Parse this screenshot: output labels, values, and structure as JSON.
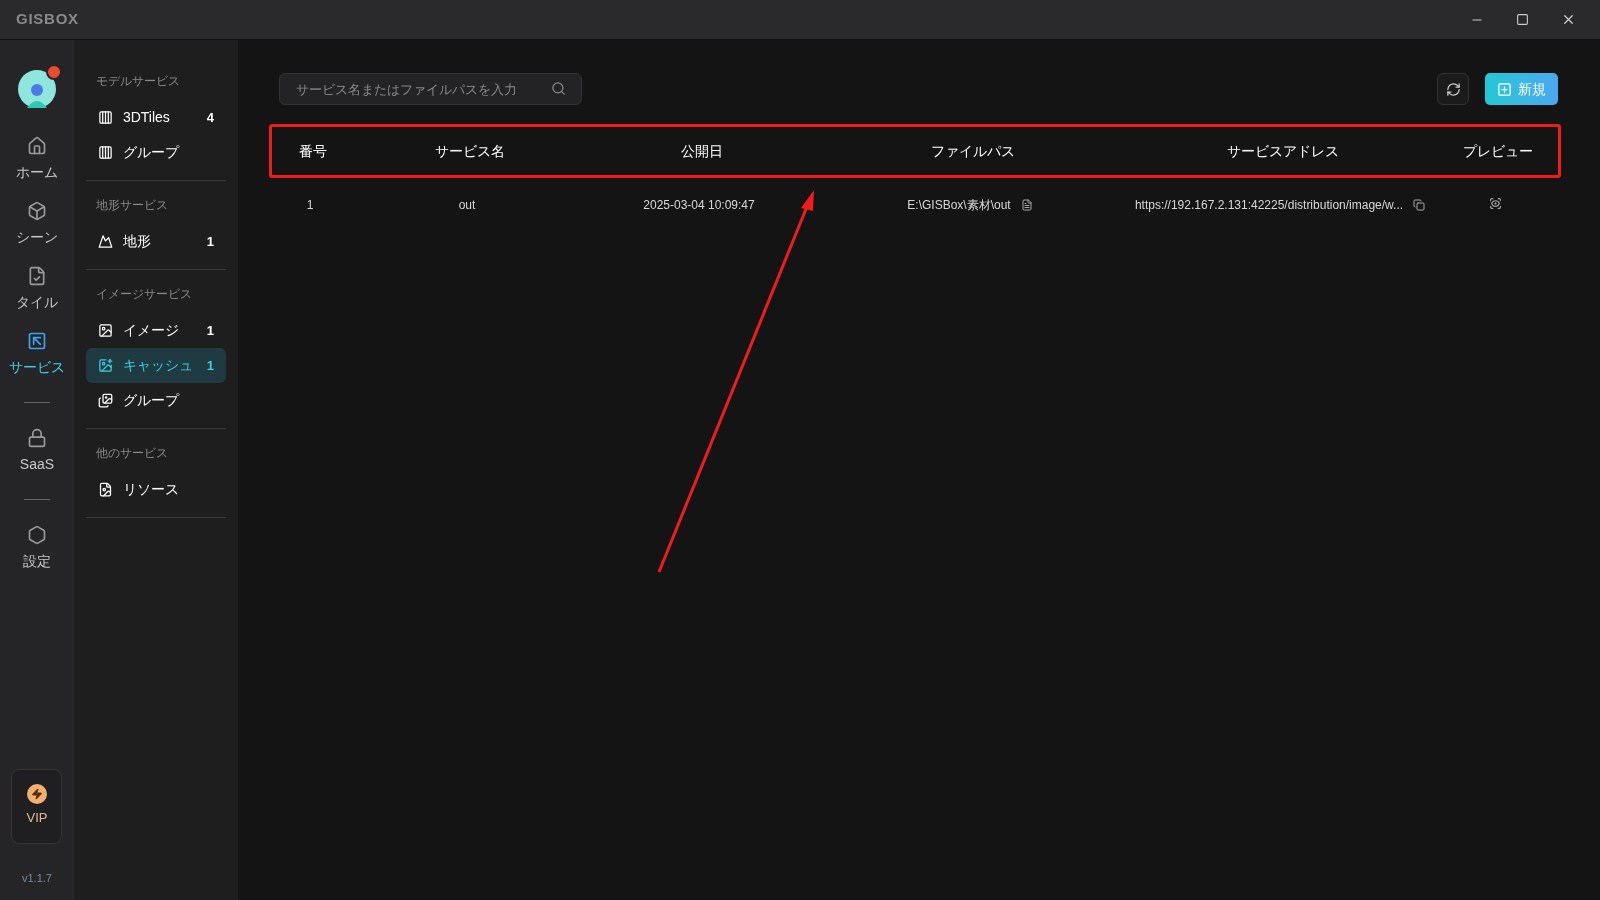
{
  "window": {
    "title": "GISBOX"
  },
  "user": {
    "has_notification": true
  },
  "rail": [
    {
      "label": "ホーム",
      "selected": false
    },
    {
      "label": "シーン",
      "selected": false
    },
    {
      "label": "タイル",
      "selected": false
    },
    {
      "label": "サービス",
      "selected": true
    },
    {
      "label": "SaaS",
      "selected": false
    },
    {
      "label": "設定",
      "selected": false
    }
  ],
  "vip": {
    "label": "VIP"
  },
  "version": "v1.1.7",
  "sections": [
    {
      "title": "モデルサービス",
      "items": [
        {
          "label": "3DTiles",
          "count": "4",
          "selected": false
        },
        {
          "label": "グループ",
          "selected": false
        }
      ]
    },
    {
      "title": "地形サービス",
      "items": [
        {
          "label": "地形",
          "count": "1",
          "selected": false
        }
      ]
    },
    {
      "title": "イメージサービス",
      "items": [
        {
          "label": "イメージ",
          "count": "1",
          "selected": false
        },
        {
          "label": "キャッシュ",
          "count": "1",
          "selected": true
        },
        {
          "label": "グループ",
          "selected": false
        }
      ]
    },
    {
      "title": "他のサービス",
      "items": [
        {
          "label": "リソース",
          "selected": false
        }
      ]
    }
  ],
  "search": {
    "placeholder": "サービス名またはファイルパスを入力"
  },
  "new_button": {
    "label": "新規"
  },
  "table": {
    "columns": [
      "番号",
      "サービス名",
      "公開日",
      "ファイルパス",
      "サービスアドレス",
      "プレビュー"
    ],
    "rows": [
      {
        "number": "1",
        "name": "out",
        "date": "2025-03-04 10:09:47",
        "path": "E:\\GISBox\\素材\\out",
        "address": "https://192.167.2.131:42225/distribution/image/w..."
      }
    ]
  }
}
